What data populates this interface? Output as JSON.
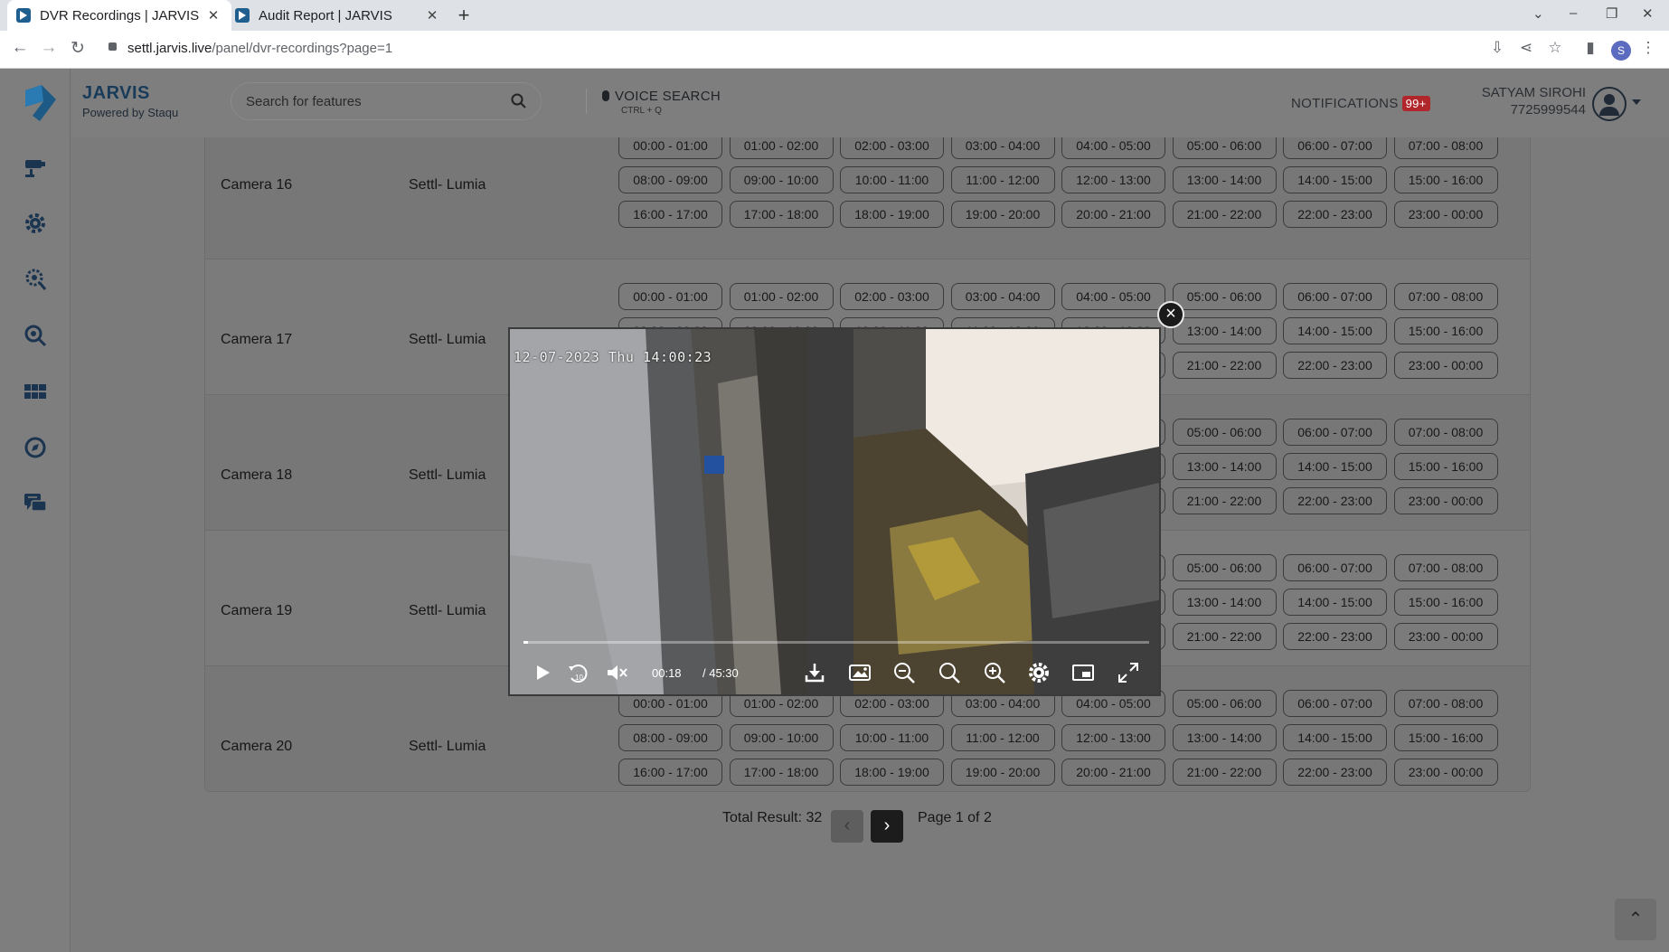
{
  "browser": {
    "tabs": [
      {
        "title": "DVR Recordings | JARVIS",
        "active": true
      },
      {
        "title": "Audit Report | JARVIS",
        "active": false
      }
    ],
    "new_tab": "+",
    "url_host": "settl.jarvis.live",
    "url_path": "/panel/dvr-recordings?page=1",
    "profile_initial": "S"
  },
  "header": {
    "brand_name": "JARVIS",
    "brand_sub": "Powered by Staqu",
    "search_placeholder": "Search for features",
    "voice_label": "VOICE SEARCH",
    "voice_shortcut": "CTRL + Q",
    "notifications_label": "NOTIFICATIONS",
    "notifications_badge": "99+",
    "user_name": "SATYAM SIROHI",
    "user_phone": "7725999544"
  },
  "sidebar": {
    "items": [
      "camera-icon",
      "settings-gear-icon",
      "search-settings-icon",
      "magnify-icon",
      "grid-icon",
      "compass-icon",
      "chat-icon"
    ]
  },
  "slots": [
    "00:00 - 01:00",
    "01:00 - 02:00",
    "02:00 - 03:00",
    "03:00 - 04:00",
    "04:00 - 05:00",
    "05:00 - 06:00",
    "06:00 - 07:00",
    "07:00 - 08:00",
    "08:00 - 09:00",
    "09:00 - 10:00",
    "10:00 - 11:00",
    "11:00 - 12:00",
    "12:00 - 13:00",
    "13:00 - 14:00",
    "14:00 - 15:00",
    "15:00 - 16:00",
    "16:00 - 17:00",
    "17:00 - 18:00",
    "18:00 - 19:00",
    "19:00 - 20:00",
    "20:00 - 21:00",
    "21:00 - 22:00",
    "22:00 - 23:00",
    "23:00 - 00:00"
  ],
  "rows": [
    {
      "camera": "Camera 16",
      "site": "Settl- Lumia"
    },
    {
      "camera": "Camera 17",
      "site": "Settl- Lumia"
    },
    {
      "camera": "Camera 18",
      "site": "Settl- Lumia"
    },
    {
      "camera": "Camera 19",
      "site": "Settl- Lumia"
    },
    {
      "camera": "Camera 20",
      "site": "Settl- Lumia"
    }
  ],
  "pagination": {
    "total_label": "Total Result: 32",
    "page_label": "Page 1 of 2"
  },
  "player": {
    "osd_text": "12-07-2023 Thu 14:00:23",
    "current_time": "00:18",
    "duration": "/ 45:30",
    "progress_fraction": 0.007,
    "rewind_label": "10"
  },
  "colors": {
    "overlay": "#7b7b7b",
    "brand": "#183b5a",
    "badge": "#b0262a"
  }
}
